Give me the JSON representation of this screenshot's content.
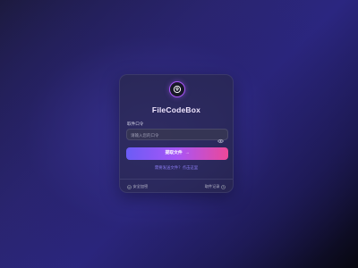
{
  "app": {
    "title": "FileCodeBox"
  },
  "form": {
    "label": "取件口令",
    "placeholder": "请输入您的口令",
    "submit_label": "提取文件",
    "submit_arrow": "→",
    "hint": "需要发送文件？点击这里"
  },
  "footer": {
    "left_label": "安全加密",
    "right_label": "取件记录"
  },
  "colors": {
    "accent_start": "#6b5cf6",
    "accent_mid": "#a855f7",
    "accent_end": "#ec4899",
    "link": "#8a7cf0"
  },
  "icons": {
    "logo": "logo-icon",
    "password_toggle": "eye-icon",
    "security": "shield-icon",
    "history": "clock-icon"
  }
}
